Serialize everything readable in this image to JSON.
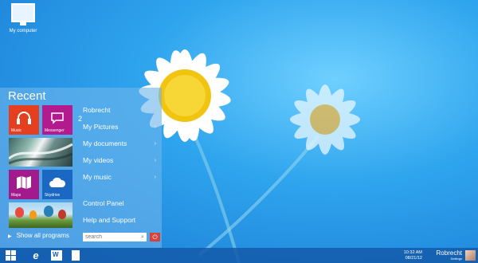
{
  "desktop": {
    "icon_label": "My computer"
  },
  "start": {
    "recent_title": "Recent",
    "tiles": {
      "music": "Music",
      "messenger": "Messenger",
      "messenger_count": "2",
      "maps": "Maps",
      "skydrive": "Skydrive"
    },
    "menu": [
      {
        "label": "Robrecht"
      },
      {
        "label": "My Pictures"
      },
      {
        "label": "My documents"
      },
      {
        "label": "My videos"
      },
      {
        "label": "My music"
      },
      {
        "label": "Control Panel"
      },
      {
        "label": "Help and Support"
      }
    ],
    "show_all_label": "Show all programs",
    "search_placeholder": "search",
    "power_icon": "power-icon"
  },
  "taskbar": {
    "time": "10:32 AM",
    "date": "08/21/12",
    "user": "Robrecht",
    "user_sub": "Settings"
  },
  "colors": {
    "music_tile": "#e4401f",
    "messenger_tile": "#b21a8e",
    "maps_tile": "#a21a8b",
    "skydrive_tile": "#1a68c2",
    "power": "#d8413a"
  }
}
